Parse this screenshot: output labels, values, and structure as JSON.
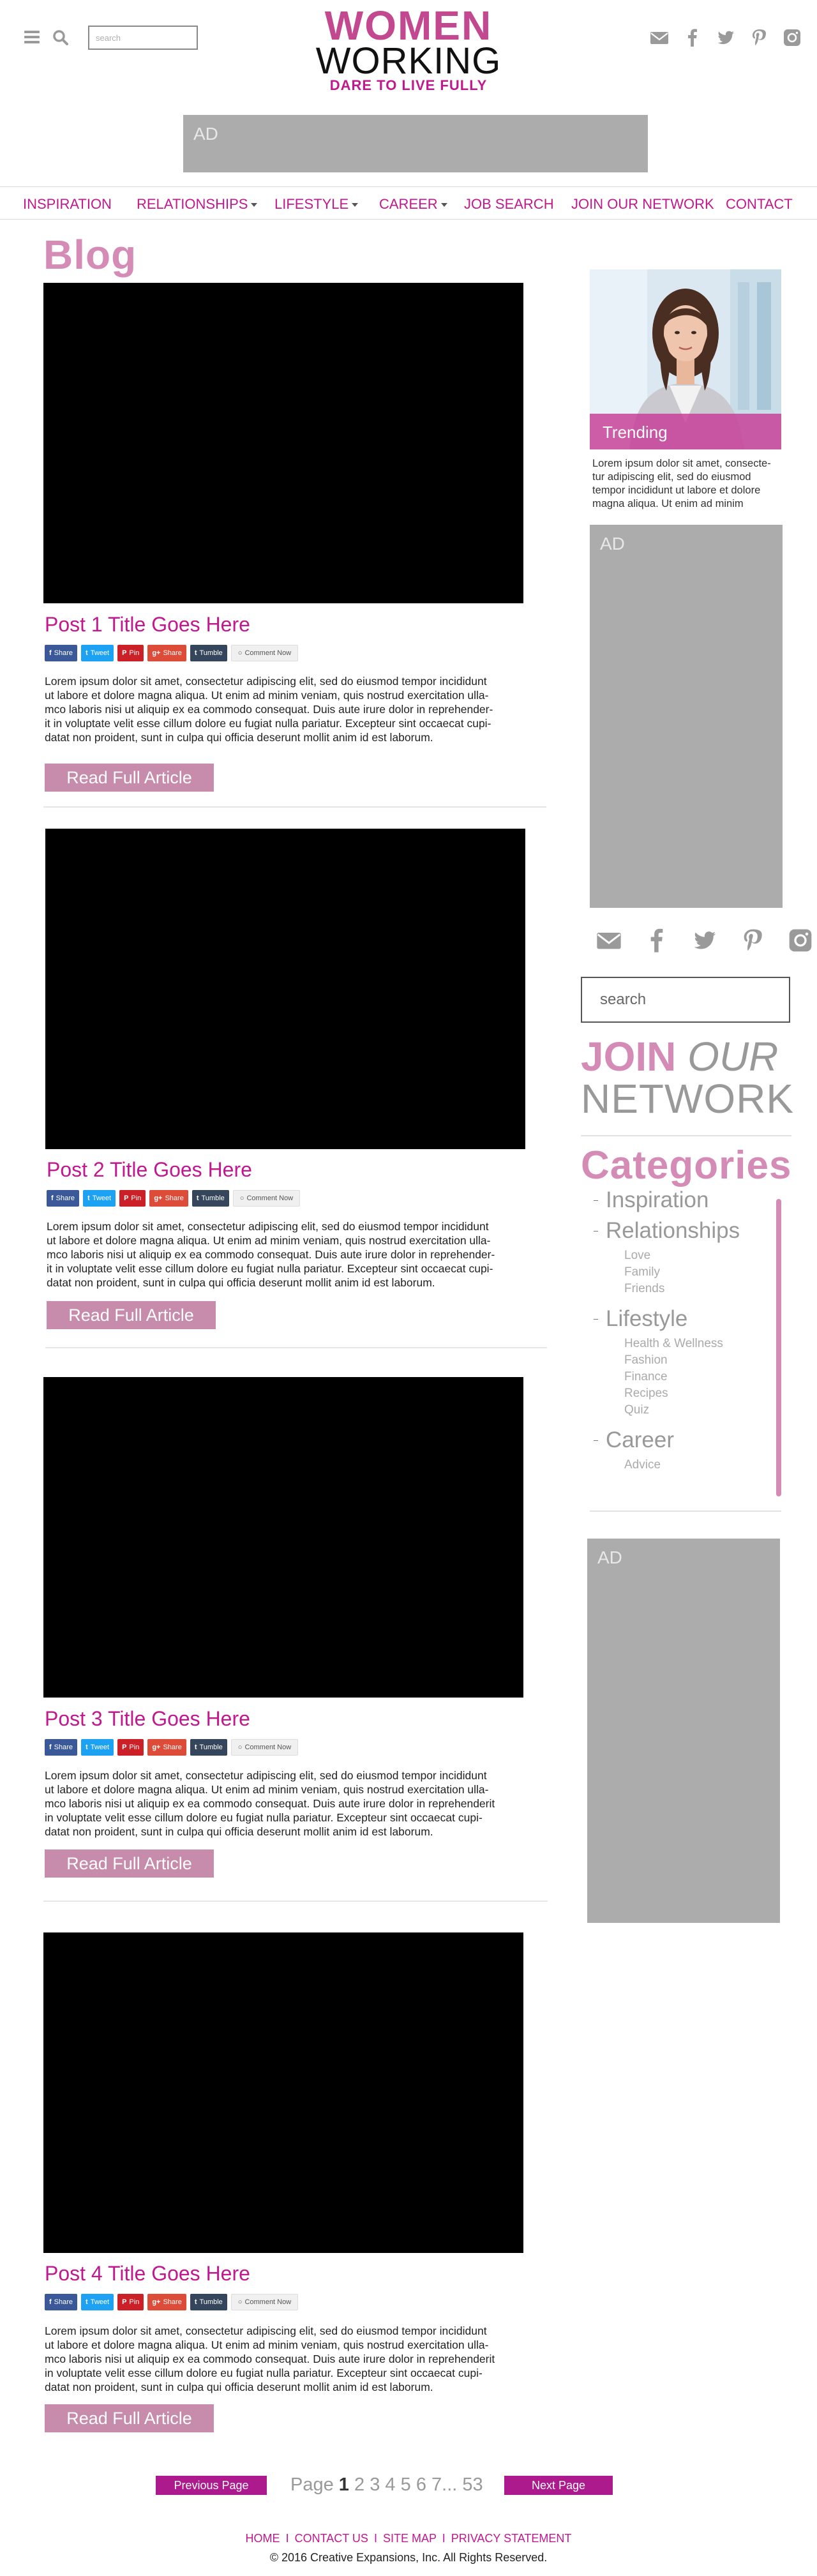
{
  "header": {
    "search_placeholder": "search",
    "logo_line1": "WOMEN",
    "logo_line2": "WORKING",
    "tagline": "DARE TO LIVE FULLY",
    "social_icons": [
      "mail-icon",
      "facebook-icon",
      "twitter-icon",
      "pinterest-icon",
      "instagram-icon"
    ]
  },
  "top_ad": {
    "label": "AD"
  },
  "nav": {
    "items": [
      {
        "label": "INSPIRATION",
        "dropdown": false
      },
      {
        "label": "RELATIONSHIPS",
        "dropdown": true
      },
      {
        "label": "LIFESTYLE",
        "dropdown": true
      },
      {
        "label": "CAREER",
        "dropdown": true
      },
      {
        "label": "JOB SEARCH",
        "dropdown": false
      },
      {
        "label": "JOIN OUR NETWORK",
        "dropdown": false
      },
      {
        "label": "CONTACT",
        "dropdown": false
      }
    ]
  },
  "blog": {
    "title": "Blog",
    "share_buttons": [
      "Share",
      "Tweet",
      "Pin",
      "Share",
      "Tumble",
      "Comment Now"
    ],
    "read_more_label": "Read Full Article",
    "body_lines": [
      "Lorem ipsum dolor sit amet, consectetur adipiscing elit, sed do eiusmod tempor incididunt",
      "ut labore et dolore magna aliqua. Ut enim ad minim veniam, quis nostrud exercitation ulla-",
      "mco laboris nisi ut aliquip ex ea commodo consequat. Duis aute irure dolor in reprehender-",
      "it in voluptate velit esse cillum dolore eu fugiat nulla pariatur. Excepteur sint occaecat cupi-",
      "datat non proident, sunt in culpa qui officia deserunt mollit anim id est laborum."
    ],
    "body_lines_alt": [
      "Lorem ipsum dolor sit amet, consectetur adipiscing elit, sed do eiusmod tempor incididunt",
      "ut labore et dolore magna aliqua. Ut enim ad minim veniam, quis nostrud exercitation ulla-",
      "mco laboris nisi ut aliquip ex ea commodo consequat. Duis aute irure dolor in reprehenderit",
      "in voluptate velit esse cillum dolore eu fugiat nulla pariatur. Excepteur sint occaecat cupi-",
      "datat non proident, sunt in culpa qui officia deserunt mollit anim id est laborum."
    ],
    "posts": [
      {
        "title": "Post 1 Title Goes Here"
      },
      {
        "title": "Post 2 Title Goes Here"
      },
      {
        "title": "Post 3 Title Goes Here"
      },
      {
        "title": "Post 4 Title Goes Here"
      }
    ]
  },
  "sidebar": {
    "trending_label": "Trending",
    "trending_text_lines": [
      "Lorem ipsum dolor sit amet, consecte-",
      "tur adipiscing elit, sed do eiusmod",
      "tempor incididunt ut labore et dolore",
      "magna aliqua. Ut enim ad minim"
    ],
    "ad_label": "AD",
    "ad2_label": "AD",
    "search_placeholder": "search",
    "join_word1": "JOIN",
    "join_word2": "OUR",
    "join_word3": "NETWORK",
    "categories_title": "Categories",
    "categories": [
      {
        "name": "Inspiration",
        "subs": []
      },
      {
        "name": "Relationships",
        "subs": [
          "Love",
          "Family",
          "Friends"
        ]
      },
      {
        "name": "Lifestyle",
        "subs": [
          "Health & Wellness",
          "Fashion",
          "Finance",
          "Recipes",
          "Quiz"
        ]
      },
      {
        "name": "Career",
        "subs": [
          "Advice"
        ]
      }
    ]
  },
  "pagination": {
    "prev_label": "Previous Page",
    "next_label": "Next Page",
    "page_word": "Page",
    "current": "1",
    "pages": [
      "2",
      "3",
      "4",
      "5",
      "6",
      "7..."
    ],
    "last": "53"
  },
  "footer": {
    "links": [
      "HOME",
      "CONTACT US",
      "SITE MAP",
      "PRIVACY STATEMENT"
    ],
    "separator": "I",
    "copyright": "© 2016 Creative Expansions, Inc. All Rights Reserved."
  },
  "colors": {
    "brand_magenta": "#c2188f",
    "pink_light": "#d48bb6",
    "read_button": "#c78bab",
    "pagination_button": "#ad1a8e",
    "ad_gray": "#acacac"
  }
}
